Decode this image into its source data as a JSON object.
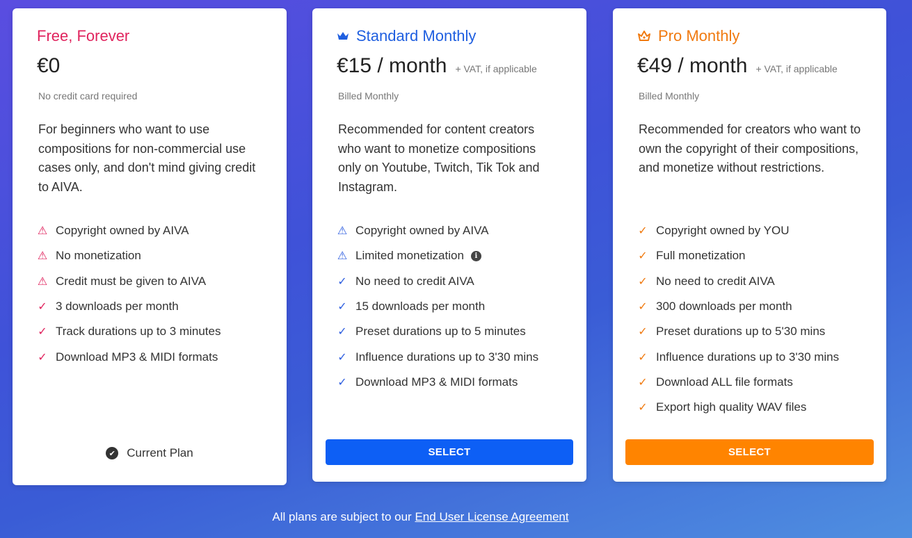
{
  "plans": {
    "free": {
      "title": "Free, Forever",
      "price": "€0",
      "billing": "No credit card required",
      "description": "For beginners who want to use compositions for non-commercial use cases only, and don't mind giving credit to AIVA.",
      "features": [
        {
          "icon": "warning-icon",
          "glyph": "⚠",
          "text": "Copyright owned by AIVA"
        },
        {
          "icon": "warning-icon",
          "glyph": "⚠",
          "text": "No monetization"
        },
        {
          "icon": "warning-icon",
          "glyph": "⚠",
          "text": "Credit must be given to AIVA"
        },
        {
          "icon": "check-icon",
          "glyph": "✓",
          "text": "3 downloads per month"
        },
        {
          "icon": "check-icon",
          "glyph": "✓",
          "text": "Track durations up to 3 minutes"
        },
        {
          "icon": "check-icon",
          "glyph": "✓",
          "text": "Download MP3 & MIDI formats"
        }
      ],
      "current_plan_label": "Current Plan",
      "accent": "#e0245e"
    },
    "standard": {
      "title": "Standard Monthly",
      "icon": "crown-icon",
      "price": "€15 / month",
      "vat": "+ VAT, if applicable",
      "billing": "Billed Monthly",
      "description": "Recommended for content creators who want to monetize compositions only on Youtube, Twitch, Tik Tok and Instagram.",
      "features": [
        {
          "icon": "warning-icon",
          "glyph": "⚠",
          "text": "Copyright owned by AIVA"
        },
        {
          "icon": "warning-icon",
          "glyph": "⚠",
          "text": "Limited monetization",
          "info": "i"
        },
        {
          "icon": "check-icon",
          "glyph": "✓",
          "text": "No need to credit AIVA"
        },
        {
          "icon": "check-icon",
          "glyph": "✓",
          "text": "15 downloads per month"
        },
        {
          "icon": "check-icon",
          "glyph": "✓",
          "text": "Preset durations up to 5 minutes"
        },
        {
          "icon": "check-icon",
          "glyph": "✓",
          "text": "Influence durations up to 3'30 mins"
        },
        {
          "icon": "check-icon",
          "glyph": "✓",
          "text": "Download MP3 & MIDI formats"
        }
      ],
      "select_label": "SELECT",
      "accent": "#1f5fe0"
    },
    "pro": {
      "title": "Pro Monthly",
      "icon": "crown-icon",
      "price": "€49 / month",
      "vat": "+ VAT, if applicable",
      "billing": "Billed Monthly",
      "description": "Recommended for creators who want to own the copyright of their compositions, and monetize without restrictions.",
      "features": [
        {
          "icon": "check-icon",
          "glyph": "✓",
          "text": "Copyright owned by YOU"
        },
        {
          "icon": "check-icon",
          "glyph": "✓",
          "text": "Full monetization"
        },
        {
          "icon": "check-icon",
          "glyph": "✓",
          "text": "No need to credit AIVA"
        },
        {
          "icon": "check-icon",
          "glyph": "✓",
          "text": "300 downloads per month"
        },
        {
          "icon": "check-icon",
          "glyph": "✓",
          "text": "Preset durations up to 5'30 mins"
        },
        {
          "icon": "check-icon",
          "glyph": "✓",
          "text": "Influence durations up to 3'30 mins"
        },
        {
          "icon": "check-icon",
          "glyph": "✓",
          "text": "Download ALL file formats"
        },
        {
          "icon": "check-icon",
          "glyph": "✓",
          "text": "Export high quality WAV files"
        }
      ],
      "select_label": "SELECT",
      "accent": "#f07a10"
    }
  },
  "footer": {
    "text": "All plans are subject to our",
    "link_label": "End User License Agreement"
  }
}
